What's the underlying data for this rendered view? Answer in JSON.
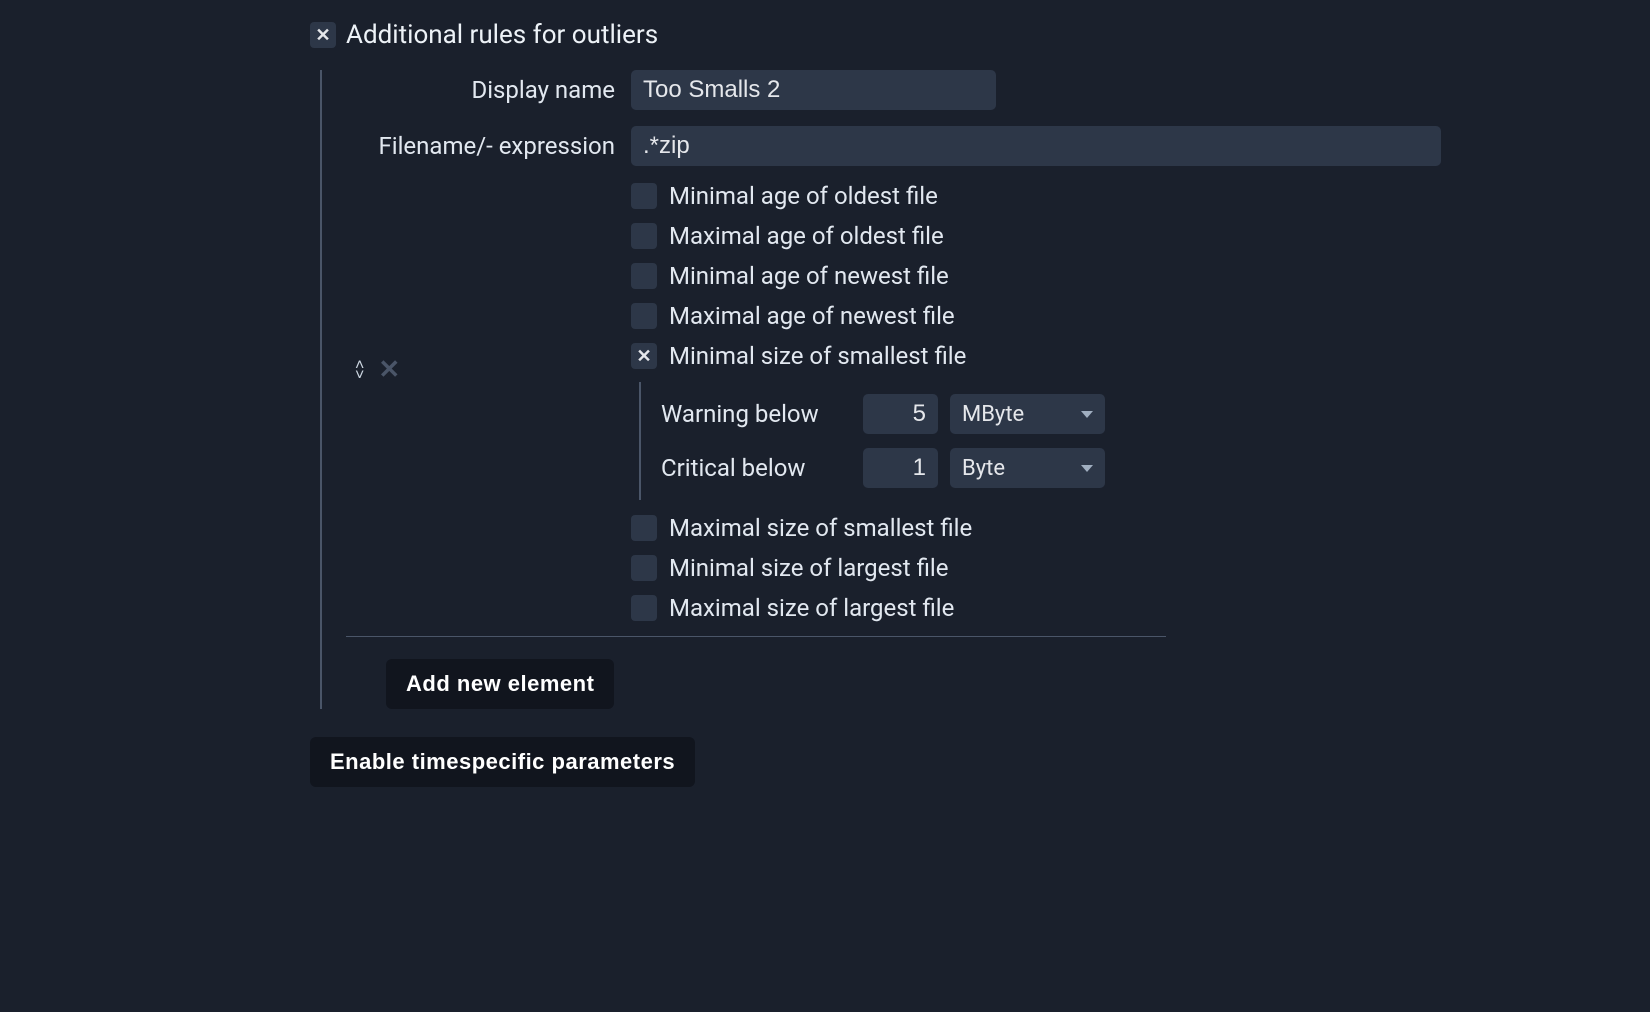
{
  "section": {
    "title": "Additional rules for outliers",
    "checked": true
  },
  "fields": {
    "display_name": {
      "label": "Display name",
      "value": "Too Smalls 2"
    },
    "filename_expr": {
      "label": "Filename/- expression",
      "value": ".*zip"
    }
  },
  "checks": {
    "min_age_oldest": {
      "label": "Minimal age of oldest file",
      "checked": false
    },
    "max_age_oldest": {
      "label": "Maximal age of oldest file",
      "checked": false
    },
    "min_age_newest": {
      "label": "Minimal age of newest file",
      "checked": false
    },
    "max_age_newest": {
      "label": "Maximal age of newest file",
      "checked": false
    },
    "min_size_smallest": {
      "label": "Minimal size of smallest file",
      "checked": true
    },
    "max_size_smallest": {
      "label": "Maximal size of smallest file",
      "checked": false
    },
    "min_size_largest": {
      "label": "Minimal size of largest file",
      "checked": false
    },
    "max_size_largest": {
      "label": "Maximal size of largest file",
      "checked": false
    }
  },
  "thresholds": {
    "warning_below": {
      "label": "Warning below",
      "value": "5",
      "unit": "MByte"
    },
    "critical_below": {
      "label": "Critical below",
      "value": "1",
      "unit": "Byte"
    }
  },
  "buttons": {
    "add_new": "Add new element",
    "enable_timespecific": "Enable timespecific parameters"
  }
}
